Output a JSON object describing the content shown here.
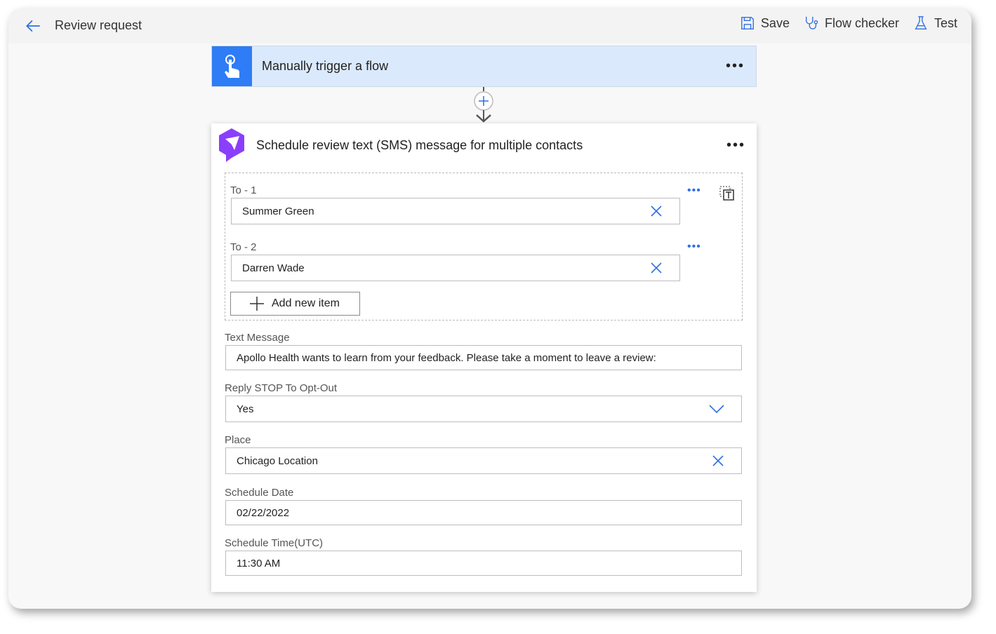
{
  "header": {
    "title": "Review request",
    "actions": [
      {
        "label": "Save",
        "icon": "save-icon"
      },
      {
        "label": "Flow checker",
        "icon": "stethoscope-icon"
      },
      {
        "label": "Test",
        "icon": "flask-icon"
      }
    ]
  },
  "trigger": {
    "title": "Manually trigger a flow"
  },
  "action": {
    "title": "Schedule review text (SMS) message for multiple contacts",
    "to": [
      {
        "label": "To - 1",
        "value": "Summer Green"
      },
      {
        "label": "To - 2",
        "value": "Darren Wade"
      }
    ],
    "add_item": "Add new item",
    "fields": [
      {
        "label": "Text Message",
        "value": "Apollo Health wants to learn from your feedback. Please take a moment to leave a review:"
      },
      {
        "label": "Reply STOP To Opt-Out",
        "value": "Yes"
      },
      {
        "label": "Place",
        "value": "Chicago Location"
      },
      {
        "label": "Schedule Date",
        "value": "02/22/2022"
      },
      {
        "label": "Schedule Time(UTC)",
        "value": "11:30 AM"
      }
    ]
  },
  "colors": {
    "accent": "#2f6fe4",
    "trigger_bg": "#dbe9fc",
    "trigger_icon": "#2e7cf6",
    "connector_icon": "#8a3ffc"
  }
}
